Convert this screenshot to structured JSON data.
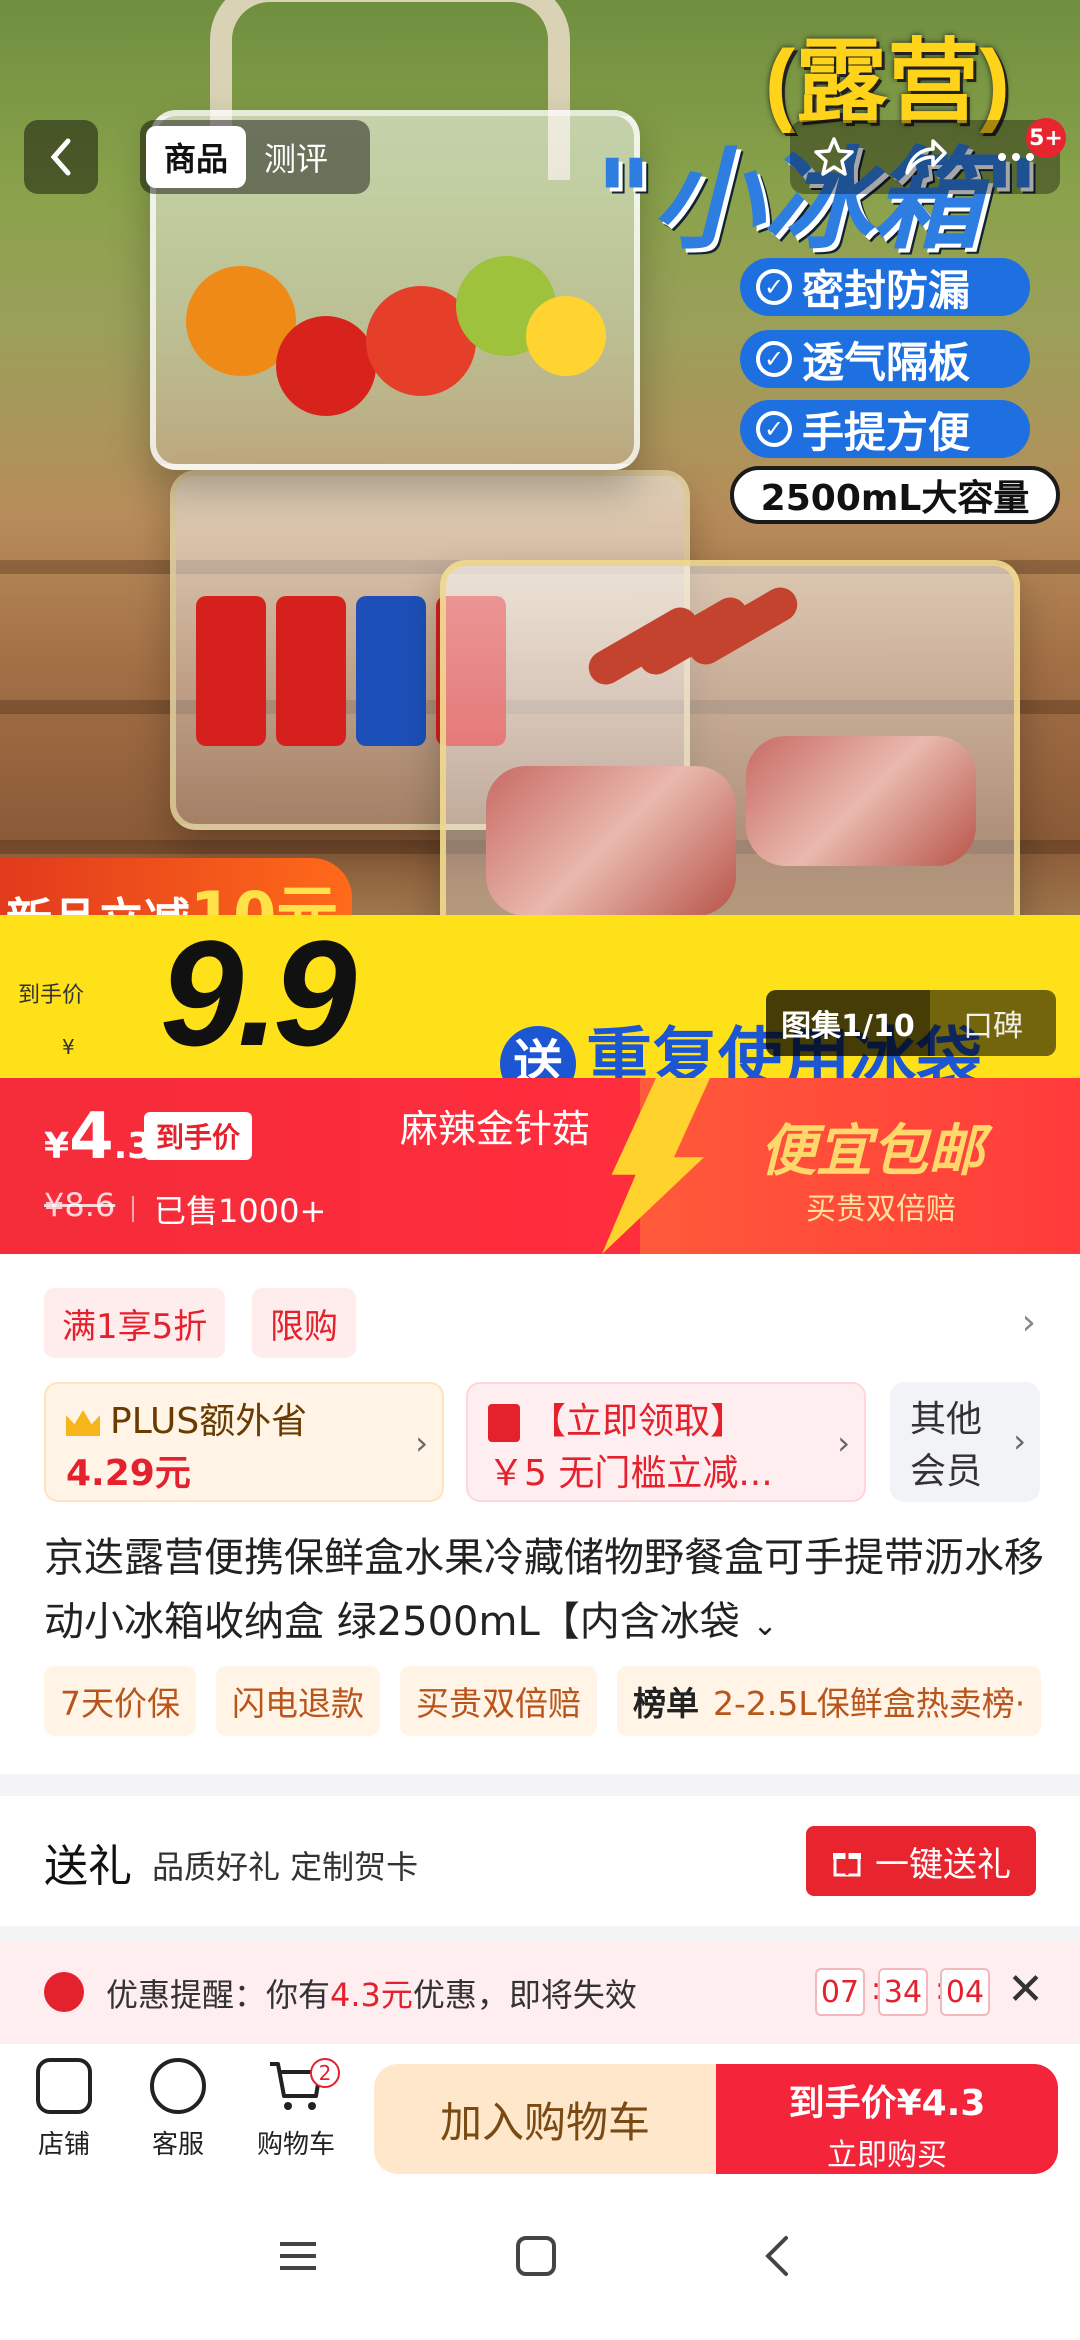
{
  "hero": {
    "title_line1": "(露营)",
    "title_line2": "\"小冰箱\"",
    "features": [
      "密封防漏",
      "透气隔板",
      "手提方便"
    ],
    "capacity": "2500mL大容量",
    "promo_new_prefix": "新品立减",
    "promo_new_amount": "10元",
    "price_label": "到手价",
    "price_yen": "¥",
    "price_big": "9.9",
    "gift_circle": "送",
    "gift_text": "重复使用冰袋"
  },
  "topbar": {
    "tabs": [
      {
        "label": "商品",
        "active": true
      },
      {
        "label": "测评",
        "active": false
      }
    ],
    "badge": "5+"
  },
  "gallery": {
    "counter": "图集1/10",
    "review": "口碑"
  },
  "price_strip": {
    "yen": "¥",
    "price_int": "4",
    "price_dec": ".3",
    "tag": "到手价",
    "original": "¥8.6",
    "sold": "已售1000+",
    "flavor": "麻辣金针菇",
    "free_ship": "便宜包邮",
    "guarantee": "买贵双倍赔"
  },
  "promos": {
    "chips": [
      "满1享5折",
      "限购"
    ],
    "plus_line1": "PLUS额外省",
    "plus_line2": "4.29元",
    "coupon_line1": "【立即领取】",
    "coupon_line2": "￥5 无门槛立减...",
    "vip_line1": "其他",
    "vip_line2": "会员"
  },
  "product": {
    "title": "京迭露营便携保鲜盒水果冷藏储物野餐盒可手提带沥水移动小冰箱收纳盒 绿2500mL【内含冰袋",
    "tags": [
      "7天价保",
      "闪电退款",
      "买贵双倍赔"
    ],
    "rank_label": "榜单",
    "rank_text": "2-2.5L保鲜盒热卖榜·"
  },
  "gift": {
    "title": "送礼",
    "subtitle": "品质好礼 定制贺卡",
    "button": "一键送礼"
  },
  "reminder": {
    "prefix": "优惠提醒：你有",
    "amount": "4.3元",
    "suffix": "优惠，即将失效",
    "hh": "07",
    "mm": "34",
    "ss": "04",
    "close": "✕"
  },
  "bottom": {
    "store": "店铺",
    "service": "客服",
    "cart": "购物车",
    "cart_count": "2",
    "add_cart": "加入购物车",
    "buy_line1": "到手价¥4.3",
    "buy_line2": "立即购买"
  },
  "colors": {
    "accent_red": "#f4243a",
    "brand_yellow": "#ffe11a",
    "brand_blue": "#1e6fe0"
  }
}
